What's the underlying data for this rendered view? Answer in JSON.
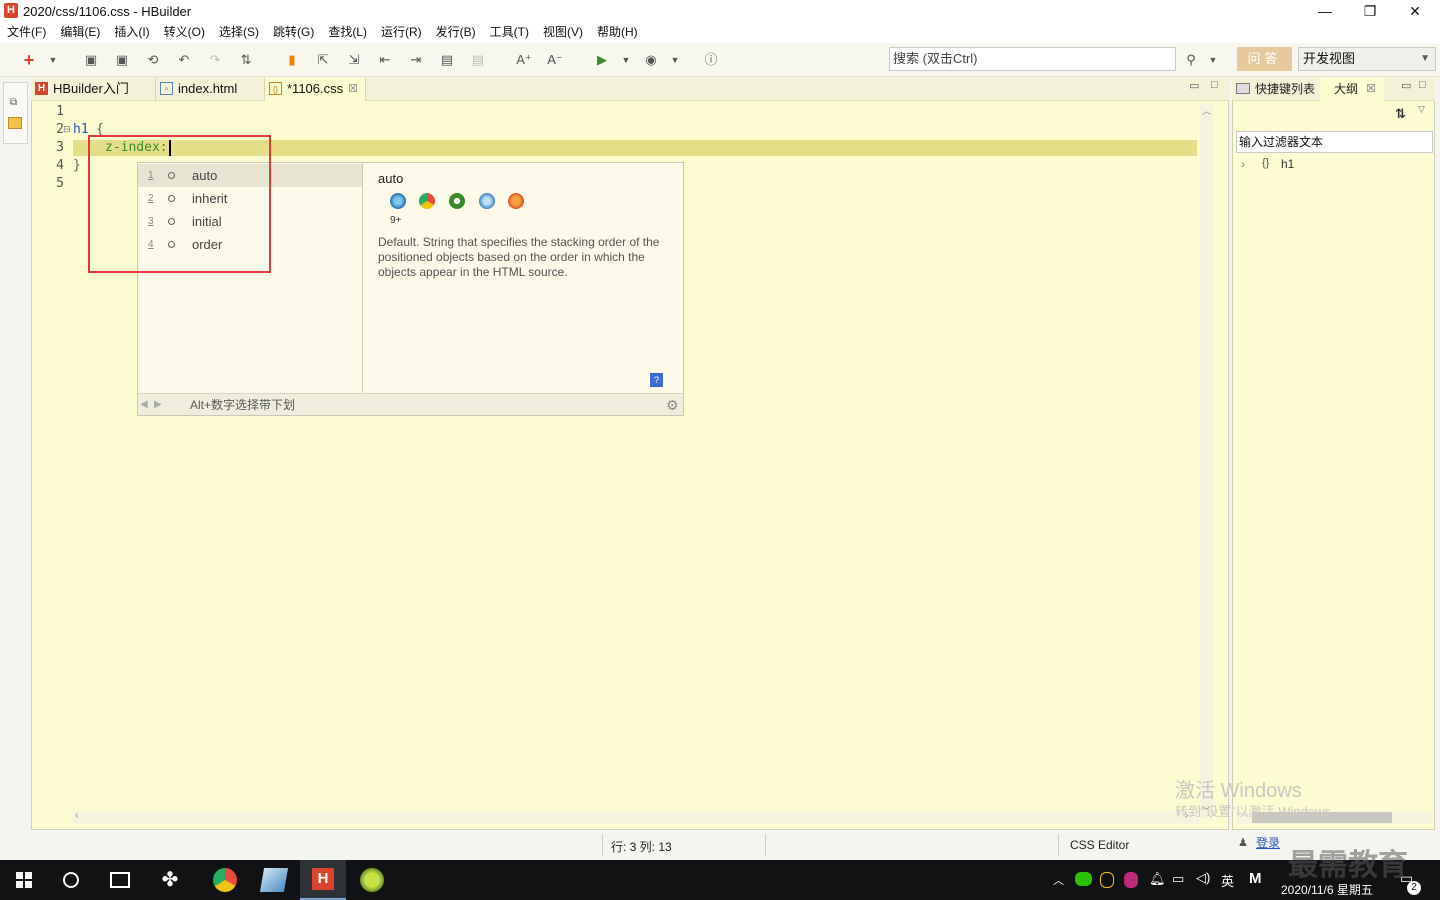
{
  "window": {
    "title": "2020/css/1106.css  -  HBuilder",
    "app_icon_letter": "H",
    "controls": {
      "minimize": "—",
      "restore": "❐",
      "close": "✕"
    }
  },
  "menubar": {
    "items": [
      "文件(F)",
      "编辑(E)",
      "插入(I)",
      "转义(O)",
      "选择(S)",
      "跳转(G)",
      "查找(L)",
      "运行(R)",
      "发行(B)",
      "工具(T)",
      "视图(V)",
      "帮助(H)"
    ]
  },
  "toolbar": {
    "search_placeholder": "搜索 (双击Ctrl)",
    "qa_label": "问答",
    "view_select": "开发视图"
  },
  "editor": {
    "tabs": [
      {
        "label": "HBuilder入门",
        "icon": "H"
      },
      {
        "label": "index.html",
        "icon": "▫"
      },
      {
        "label": "*1106.css",
        "icon": "{}",
        "close": "☒"
      }
    ],
    "lines": [
      "1",
      "2",
      "3",
      "4",
      "5"
    ],
    "code": {
      "line2_selector": "h1",
      "line2_brace": "{",
      "line3_property": "z-index:",
      "line4_brace": "}"
    }
  },
  "autocomplete": {
    "items": [
      {
        "num": "1",
        "label": "auto"
      },
      {
        "num": "2",
        "label": "inherit"
      },
      {
        "num": "3",
        "label": "initial"
      },
      {
        "num": "4",
        "label": "order"
      }
    ],
    "selected_index": 0,
    "detail_title": "auto",
    "browser_icons": [
      "ie-icon",
      "chrome-icon",
      "android-icon",
      "safari-icon",
      "firefox-icon"
    ],
    "ie_version": "9+",
    "description": "Default. String that specifies the stacking order of the positioned objects based on the order in which the objects appear in the HTML source.",
    "footer_hint": "Alt+数字选择带下划"
  },
  "right_panel": {
    "tabs": [
      {
        "label": "快捷键列表"
      },
      {
        "label": "大纲",
        "close": "☒"
      }
    ],
    "filter_placeholder": "输入过滤器文本",
    "outline_item": "h1"
  },
  "statusbar": {
    "position": "行: 3 列: 13",
    "editor_type": "CSS Editor",
    "login": "登录"
  },
  "taskbar": {
    "ime": "英",
    "datetime": "2020/11/6 星期五",
    "notification_count": "2"
  },
  "watermark": {
    "activate_title": "激活 Windows",
    "activate_sub": "转到“设置”以激活 Windows。",
    "brand": "最需教育"
  },
  "colors": {
    "editor_bg": "#fdfbd0",
    "current_line": "#e4de89",
    "highlight_box": "#e03c3c",
    "selector_blue": "#2b4fbd",
    "property_green": "#3a8a2a"
  }
}
